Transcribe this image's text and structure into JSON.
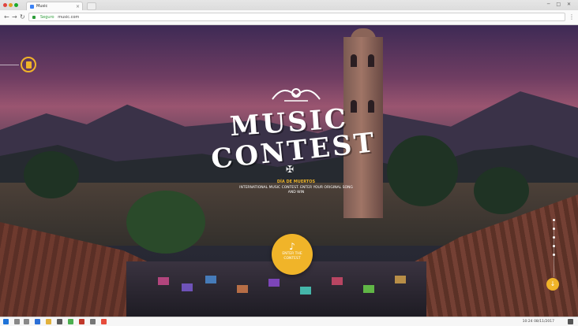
{
  "browser": {
    "tab_title": "Music",
    "url_secure": "Seguro",
    "url": "music.com",
    "back": "←",
    "forward": "→",
    "reload": "↻",
    "menu": "⋮"
  },
  "hero": {
    "title_line1": "MUSIC",
    "title_line2": "CONTEST",
    "subtitle": "DÍA DE MUERTOS",
    "description": "INTERNATIONAL MUSIC CONTEST. ENTER YOUR ORIGINAL SONG AND WIN",
    "cta_label": "ENTER THE CONTEST",
    "cta_icon": "♪",
    "ornament_icon": "❦",
    "cross_icon": "✠",
    "scroll_icon": "↓"
  },
  "taskbar": {
    "clock": "10:24",
    "date": "08/11/2017"
  },
  "colors": {
    "accent": "#f0b429",
    "sky_top": "#3e2a55",
    "sky_glow": "#9a5570"
  }
}
